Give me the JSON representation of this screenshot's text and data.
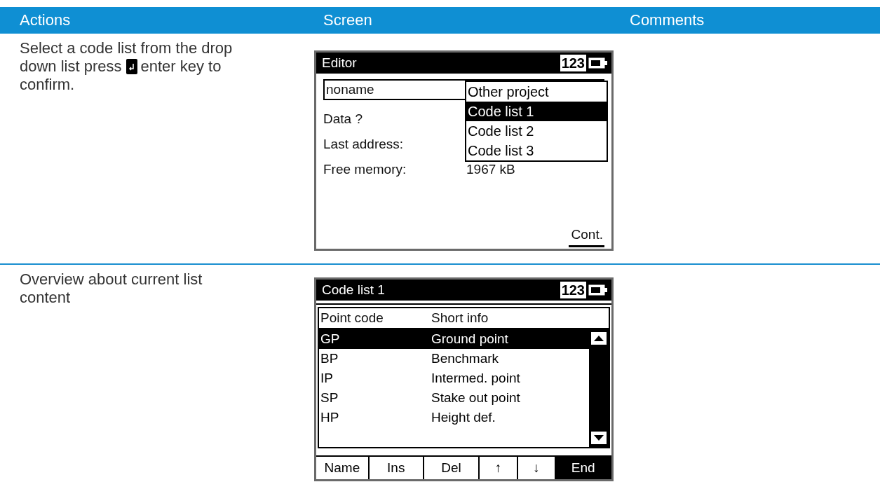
{
  "header": {
    "columns": [
      "Actions",
      "Screen",
      "Comments"
    ]
  },
  "rows": [
    {
      "action_lines": [
        [
          {
            "kind": "text",
            "text": "Select a code list from the drop"
          }
        ],
        [
          {
            "kind": "text",
            "text": "down list press"
          },
          {
            "kind": "key"
          },
          {
            "kind": "text",
            "text": "enter key to"
          }
        ],
        [
          {
            "kind": "text",
            "text": "confirm."
          }
        ]
      ],
      "screen": {
        "kind": "editor",
        "title": "Editor",
        "mode": "123",
        "field_value": "noname",
        "fields": [
          {
            "label": "Data ?"
          },
          {
            "label": "Last address:"
          },
          {
            "label": "Free memory:",
            "value": "1967 kB"
          }
        ],
        "dropdown": [
          {
            "label": "Other project",
            "selected": false
          },
          {
            "label": "Code list 1",
            "selected": true
          },
          {
            "label": "Code list 2",
            "selected": false
          },
          {
            "label": "Code list 3",
            "selected": false
          }
        ],
        "softkey": "Cont."
      }
    },
    {
      "action_lines": [
        [
          {
            "kind": "text",
            "text": "Overview about current list"
          }
        ],
        [
          {
            "kind": "text",
            "text": "content"
          }
        ]
      ],
      "screen": {
        "kind": "list",
        "title": "Code list 1",
        "mode": "123",
        "columns": [
          "Point code",
          "Short info"
        ],
        "items": [
          {
            "code": "GP",
            "info": "Ground point",
            "selected": true
          },
          {
            "code": "BP",
            "info": "Benchmark",
            "selected": false
          },
          {
            "code": "IP",
            "info": "Intermed. point",
            "selected": false
          },
          {
            "code": "SP",
            "info": "Stake out point",
            "selected": false
          },
          {
            "code": "HP",
            "info": "Height def.",
            "selected": false
          }
        ],
        "softkeys": [
          {
            "label": "Name",
            "selected": false
          },
          {
            "label": "Ins",
            "selected": false
          },
          {
            "label": "Del",
            "selected": false
          },
          {
            "label": "↑",
            "selected": false
          },
          {
            "label": "↓",
            "selected": false
          },
          {
            "label": "End",
            "selected": true
          }
        ]
      }
    }
  ]
}
